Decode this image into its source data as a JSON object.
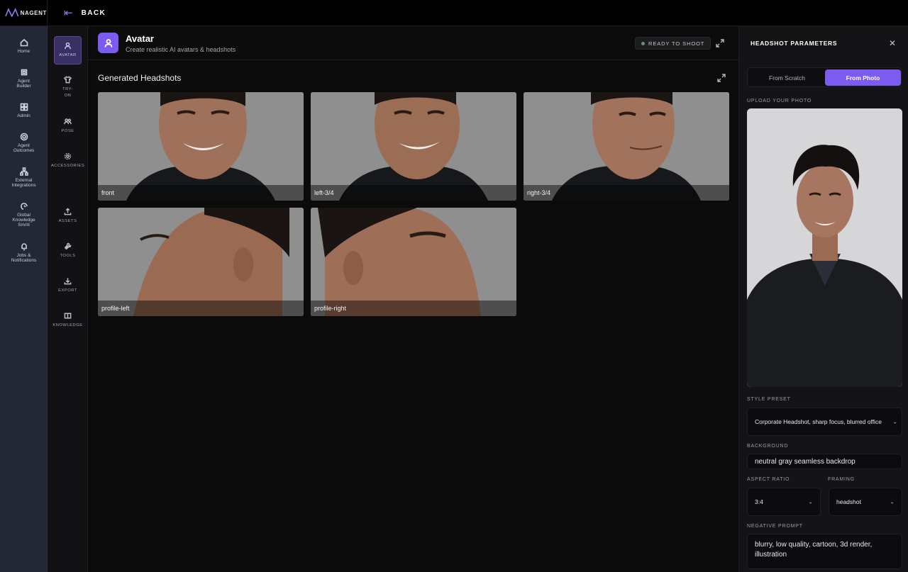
{
  "brand": {
    "logo_text": "NAGENT"
  },
  "topbar": {
    "back_label": "BACK"
  },
  "rail": {
    "items": [
      {
        "label": "Home",
        "icon": "home-icon"
      },
      {
        "label": "Agent\nBuilder",
        "icon": "cpu-icon"
      },
      {
        "label": "Admin",
        "icon": "grid-icon"
      },
      {
        "label": "Agent\nOutcomes",
        "icon": "target-icon"
      },
      {
        "label": "External\nIntegrations",
        "icon": "network-icon"
      },
      {
        "label": "Global\nKnowledge\nSmriti",
        "icon": "brain-icon"
      },
      {
        "label": "Jobs &\nNotifications",
        "icon": "bell-icon"
      }
    ]
  },
  "subnav": {
    "items": [
      {
        "label": "AVATAR",
        "icon": "user-icon",
        "active": true
      },
      {
        "label": "TRY-\nON",
        "icon": "shirt-icon"
      },
      {
        "label": "POSE",
        "icon": "users-icon"
      },
      {
        "label": "ACCESSORIES",
        "icon": "gear-icon"
      },
      {
        "label": "ASSETS",
        "icon": "upload-icon"
      },
      {
        "label": "TOOLS",
        "icon": "wrench-icon"
      },
      {
        "label": "EXPORT",
        "icon": "download-icon"
      },
      {
        "label": "KNOWLEDGE",
        "icon": "book-icon"
      }
    ]
  },
  "header": {
    "title": "Avatar",
    "subtitle": "Create realistic AI avatars & headshots",
    "status": "READY TO SHOOT"
  },
  "gallery": {
    "title": "Generated Headshots",
    "tiles": [
      {
        "caption": "front"
      },
      {
        "caption": "left-3/4"
      },
      {
        "caption": "right-3/4"
      },
      {
        "caption": "profile-left"
      },
      {
        "caption": "profile-right"
      }
    ]
  },
  "panel": {
    "title": "HEADSHOT PARAMETERS",
    "tabs": [
      "From Scratch",
      "From Photo"
    ],
    "active_tab": "From Photo",
    "upload_label": "UPLOAD YOUR PHOTO",
    "style_preset_label": "STYLE PRESET",
    "style_preset_value": "Corporate Headshot, sharp focus, blurred office",
    "background_label": "BACKGROUND",
    "background_value": "neutral gray seamless backdrop",
    "aspect_ratio_label": "ASPECT RATIO",
    "aspect_ratio_value": "3:4",
    "framing_label": "FRAMING",
    "framing_value": "headshot",
    "negative_prompt_label": "NEGATIVE PROMPT",
    "negative_prompt_value": "blurry, low quality, cartoon, 3d render, illustration"
  },
  "colors": {
    "accent": "#7c5cf0",
    "rail_bg": "#232836",
    "panel_bg": "#141416"
  }
}
